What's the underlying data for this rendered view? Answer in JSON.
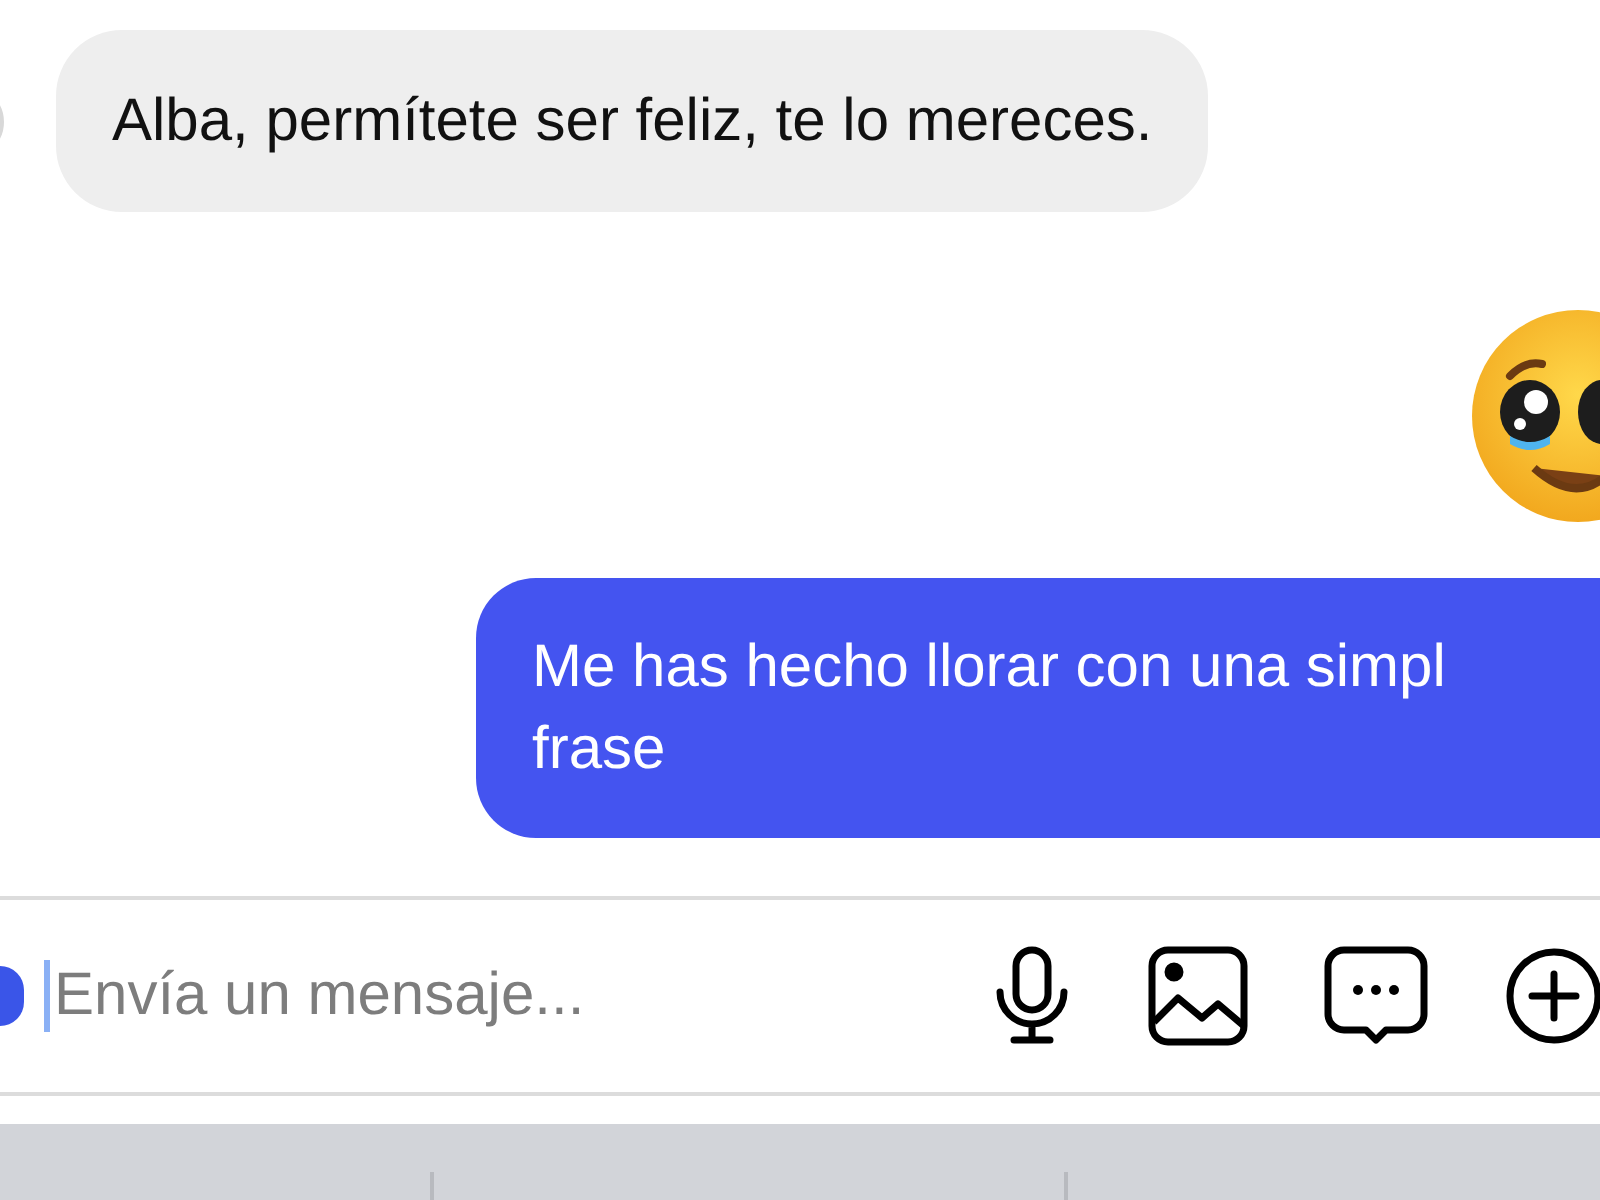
{
  "messages": [
    {
      "kind": "received",
      "text": "Alba, permítete ser feliz, te lo mereces."
    },
    {
      "kind": "emoji"
    },
    {
      "kind": "sent",
      "lines": [
        "Me has hecho llorar con una simpl",
        "frase"
      ]
    }
  ],
  "composer": {
    "placeholder": "Envía un mensaje..."
  }
}
